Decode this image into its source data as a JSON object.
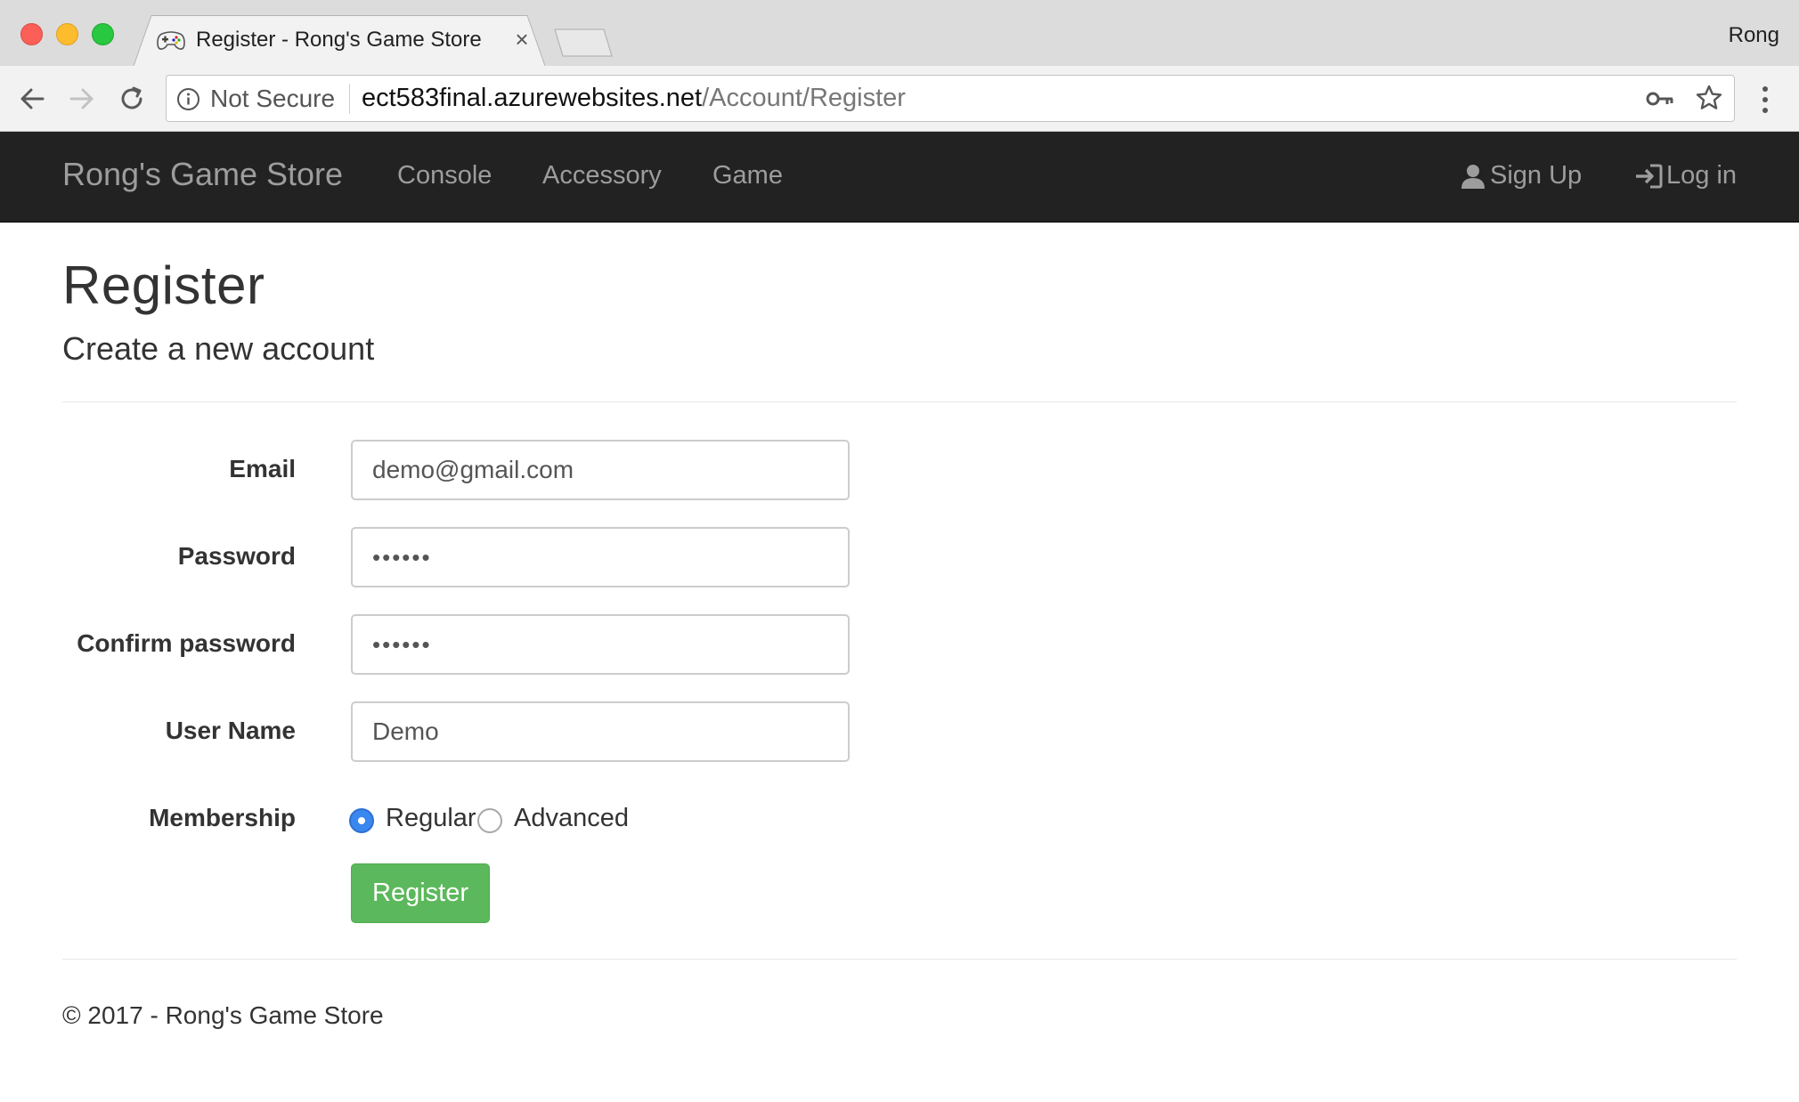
{
  "browser": {
    "tab_title": "Register - Rong's Game Store",
    "tab_close": "×",
    "profile_name": "Rong",
    "security_label": "Not Secure",
    "url_host": "ect583final.azurewebsites.net",
    "url_path": "/Account/Register"
  },
  "navbar": {
    "brand": "Rong's Game Store",
    "links": [
      "Console",
      "Accessory",
      "Game"
    ],
    "sign_up": "Sign Up",
    "log_in": "Log in"
  },
  "page": {
    "title": "Register",
    "subtitle": "Create a new account"
  },
  "form": {
    "email_label": "Email",
    "email_value": "demo@gmail.com",
    "password_label": "Password",
    "password_value": "••••••",
    "confirm_label": "Confirm password",
    "confirm_value": "••••••",
    "username_label": "User Name",
    "username_value": "Demo",
    "membership_label": "Membership",
    "membership_options": [
      "Regular",
      "Advanced"
    ],
    "membership_selected": "Regular",
    "submit_label": "Register"
  },
  "footer": {
    "text": "© 2017 - Rong's Game Store"
  },
  "colors": {
    "navbar_bg": "#222222",
    "nav_text": "#9d9d9d",
    "button_green": "#5cb85c",
    "radio_blue": "#3a87f0"
  }
}
